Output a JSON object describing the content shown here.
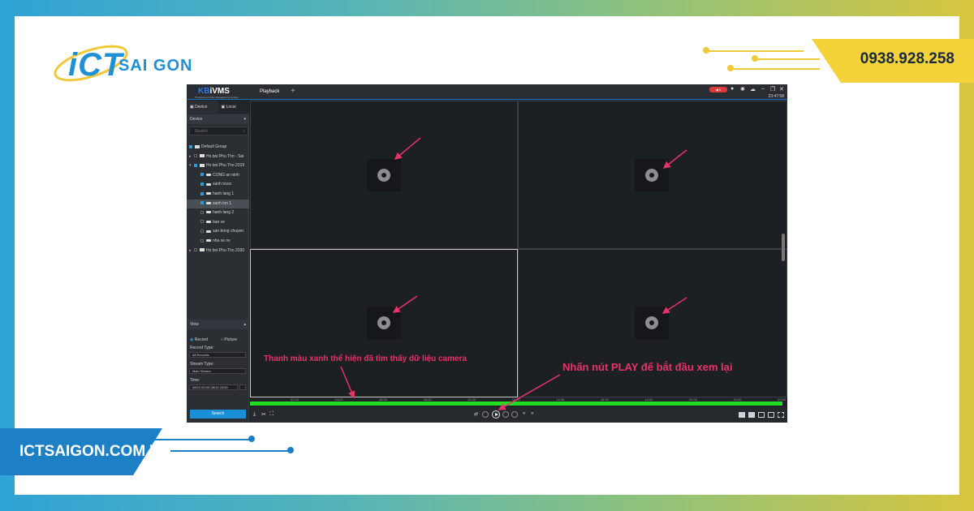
{
  "brand": {
    "logo_ict": "iCT",
    "logo_name": "SAI GON",
    "phone": "0938.928.258",
    "website": "ICTSAIGON.COM.VN"
  },
  "app": {
    "logo": "KBiVMS",
    "logo_prefix": "KB",
    "logo_suffix": "iVMS",
    "logo_sub": "Professional Video Management System",
    "tab": "Playback",
    "clock": "23:47:58"
  },
  "sidebar": {
    "tab_device": "Device",
    "tab_local": "Local",
    "device_header": "Device",
    "search_placeholder": "Search",
    "tree": [
      {
        "label": "Default Group",
        "level": 0,
        "checked": true,
        "kind": "group"
      },
      {
        "label": "Ho boi Phu Tho - Sai",
        "level": 0,
        "checked": false,
        "kind": "folder",
        "collapsed": true
      },
      {
        "label": "Ho boi Phu Tho 2019",
        "level": 0,
        "checked": true,
        "kind": "folder",
        "collapsed": false
      },
      {
        "label": "CONG an ninh",
        "level": 1,
        "checked": true,
        "kind": "cam"
      },
      {
        "label": "sanh truoc",
        "level": 1,
        "checked": true,
        "kind": "cam"
      },
      {
        "label": "hanh lang 1",
        "level": 1,
        "checked": true,
        "kind": "cam"
      },
      {
        "label": "sanh ion 1",
        "level": 1,
        "checked": true,
        "kind": "cam",
        "selected": true
      },
      {
        "label": "hanh lang 2",
        "level": 1,
        "checked": false,
        "kind": "cam"
      },
      {
        "label": "ban ve",
        "level": 1,
        "checked": false,
        "kind": "cam"
      },
      {
        "label": "san bong chuyen",
        "level": 1,
        "checked": false,
        "kind": "cam"
      },
      {
        "label": "nha xe nv",
        "level": 1,
        "checked": false,
        "kind": "cam"
      },
      {
        "label": "Ho boi Phu Tho 2020",
        "level": 0,
        "checked": false,
        "kind": "folder",
        "collapsed": true
      }
    ],
    "view_header": "View",
    "radio_record": "Record",
    "radio_picture": "Picture",
    "record_type_label": "Record Type:",
    "record_type_value": "All Records",
    "stream_type_label": "Stream Type:",
    "stream_type_value": "Main Stream",
    "time_label": "Time:",
    "time_value": "08/10 00:00-08/19 23:59",
    "search_button": "Search"
  },
  "timeline": {
    "ticks": [
      "02:00",
      "04:00",
      "06:00",
      "08:00",
      "10:00",
      "12:00",
      "14:00",
      "16:00",
      "18:00",
      "20:00",
      "22:00",
      "00:00"
    ]
  },
  "annotations": {
    "green_bar_note": "Thanh màu xanh thể hiện đã tìm thấy dữ liệu camera",
    "play_note": "Nhấn nút PLAY để bắt đầu xem lại"
  },
  "colors": {
    "accent": "#1a8fd8",
    "timeline_bar": "#22dd22",
    "annotation": "#e8326a",
    "phone_banner": "#f3d23a"
  }
}
